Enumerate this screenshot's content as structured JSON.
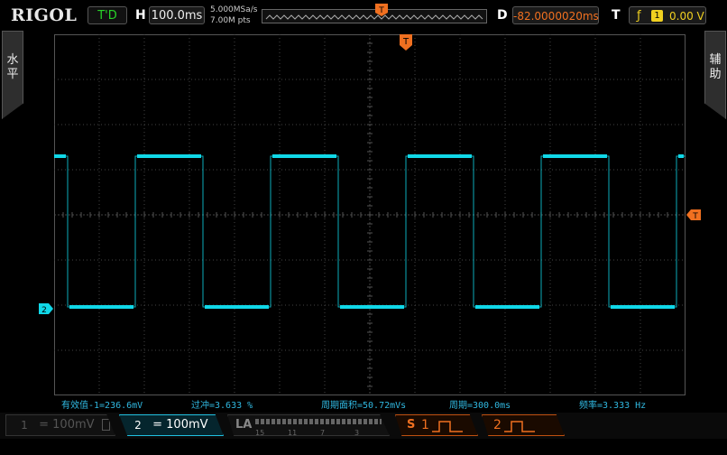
{
  "topbar": {
    "logo": "RIGOL",
    "trigger_status": "T'D",
    "h_label": "H",
    "timebase": "100.0ms",
    "sample_rate": "5.000MSa/s",
    "memory_depth": "7.00M pts",
    "delay_label": "D",
    "delay_value": "-82.0000020ms",
    "trigger_label": "T",
    "trigger_source": "1",
    "trigger_level": "0.00 V"
  },
  "side_tabs": {
    "left": [
      "水",
      "平"
    ],
    "right": [
      "辅",
      "助"
    ]
  },
  "markers": {
    "trigger_pos": "T",
    "trigger_level": "T",
    "channel_ref": "2"
  },
  "measurements": [
    "有效值-1=236.6mV",
    "过冲=3.633 %",
    "周期面积=50.72mVs",
    "周期=300.0ms",
    "频率=3.333 Hz"
  ],
  "bottombar": {
    "ch1_num": "1",
    "ch1_scale": "= 100mV",
    "ch2_num": "2",
    "ch2_scale": "= 100mV",
    "la_label": "LA",
    "la_numbers": [
      "15",
      "11",
      "7",
      "3"
    ],
    "s1_label": "S",
    "s1_num": "1",
    "s2_num": "2"
  },
  "colors": {
    "trace": "#10d8e8",
    "accent": "#f07020",
    "measure_text": "#30b8e0",
    "trigger_ok": "#28d228"
  }
}
